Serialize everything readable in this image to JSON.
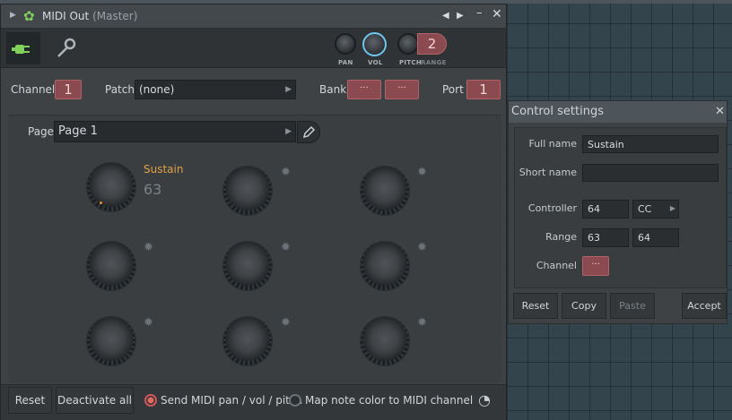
{
  "window": {
    "title": "MIDI Out",
    "subtitle": "(Master)"
  },
  "toolbar": {
    "knobs": [
      "PAN",
      "VOL",
      "PITCH"
    ],
    "range_value": "2",
    "range_label": "RANGE"
  },
  "params": {
    "channel_label": "Channel",
    "channel_value": "1",
    "patch_label": "Patch",
    "patch_value": "(none)",
    "bank_label": "Bank",
    "bank_value1": "···",
    "bank_value2": "···",
    "port_label": "Port",
    "port_value": "1"
  },
  "page": {
    "label": "Page",
    "value": "Page 1"
  },
  "knob1": {
    "name": "Sustain",
    "value": "63"
  },
  "footer": {
    "reset": "Reset",
    "deactivate": "Deactivate all",
    "send_midi": "Send MIDI pan / vol / pitch",
    "map_color": "Map note color to MIDI channel",
    "send_midi_checked": true,
    "map_color_checked": false
  },
  "control_settings": {
    "title": "Control settings",
    "full_name_label": "Full name",
    "full_name_value": "Sustain",
    "short_name_label": "Short name",
    "short_name_value": "",
    "controller_label": "Controller",
    "controller_value": "64",
    "controller_type": "CC",
    "range_label": "Range",
    "range_min": "63",
    "range_max": "64",
    "channel_label": "Channel",
    "channel_value": "···",
    "reset": "Reset",
    "copy": "Copy",
    "paste": "Paste",
    "accept": "Accept"
  },
  "colors": {
    "accent_green": "#7fd15a",
    "sustain_orange": "#e0a044",
    "red_box": "#8a4a50",
    "vol_ring": "#6ec6ef"
  },
  "icons": [
    "plug-icon",
    "wrench-icon",
    "gear-icon",
    "pencil-icon",
    "close-icon",
    "arrow-left-icon",
    "arrow-right-icon",
    "minimize-icon"
  ]
}
